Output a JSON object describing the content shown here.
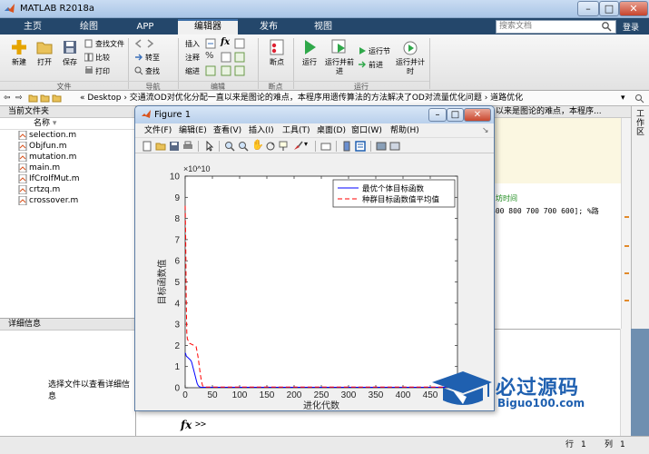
{
  "window": {
    "title": "MATLAB R2018a"
  },
  "ribbon_tabs": [
    "主页",
    "绘图",
    "APP",
    "编辑器",
    "发布",
    "视图"
  ],
  "search": {
    "placeholder": "搜索文档"
  },
  "signin": "登录",
  "ribbon": {
    "file": {
      "new": "新建",
      "open": "打开",
      "save": "保存",
      "find_files": "查找文件",
      "compare": "比较",
      "print": "打印",
      "section": "文件"
    },
    "nav": {
      "goto": "转至",
      "find": "查找",
      "section": "导航"
    },
    "edit": {
      "insert": "插入",
      "comment": "注释",
      "indent": "缩进",
      "section": "编辑"
    },
    "breakpoints": {
      "label": "断点",
      "section": "断点"
    },
    "run": {
      "run": "运行",
      "run_advance": "运行并前进",
      "run_section": "运行节",
      "advance": "前进",
      "run_time": "运行并计时",
      "section": "运行"
    }
  },
  "address": {
    "path": "« Desktop › 交通流OD对优化分配一直以来是图论的难点，本程序用遗传算法的方法解决了OD对流量优化问题 › 道路优化"
  },
  "current_folder": {
    "title": "当前文件夹",
    "column": "名称",
    "files": [
      "selection.m",
      "Objfun.m",
      "mutation.m",
      "main.m",
      "IfCroIfMut.m",
      "crtzq.m",
      "crossover.m"
    ]
  },
  "details": {
    "title": "详细信息",
    "message": "选择文件以查看详细信息"
  },
  "editor": {
    "tab_text": "以来是图论的难点，本程序...",
    "code_comment": "坊时间",
    "code_line": "400 800 700 700 600];  %路"
  },
  "workspace_label": "工作区",
  "command": {
    "fx": "fx",
    "prompt": ">>"
  },
  "status": {
    "row_label": "行",
    "row": "1",
    "col_label": "列",
    "col": "1"
  },
  "figure": {
    "title": "Figure 1",
    "menu": [
      "文件(F)",
      "编辑(E)",
      "查看(V)",
      "插入(I)",
      "工具(T)",
      "桌面(D)",
      "窗口(W)",
      "帮助(H)"
    ]
  },
  "chart_data": {
    "type": "line",
    "title": "",
    "xlabel": "进化代数",
    "ylabel": "目标函数值",
    "y_exponent": "×10^10",
    "xlim": [
      0,
      500
    ],
    "ylim": [
      0,
      10
    ],
    "xticks": [
      0,
      50,
      100,
      150,
      200,
      250,
      300,
      350,
      400,
      450
    ],
    "yticks": [
      0,
      1,
      2,
      3,
      4,
      5,
      6,
      7,
      8,
      9,
      10
    ],
    "legend_position": "top-right",
    "series": [
      {
        "name": "最优个体目标函数",
        "color": "#0000ff",
        "style": "solid",
        "x": [
          0,
          1,
          2,
          4,
          6,
          8,
          10,
          12,
          14,
          16,
          18,
          20,
          22,
          24,
          26,
          28,
          30,
          500
        ],
        "y": [
          1.65,
          1.6,
          1.5,
          1.45,
          1.4,
          1.35,
          1.3,
          1.2,
          1.0,
          0.8,
          0.6,
          0.4,
          0.2,
          0.1,
          0.05,
          0.03,
          0.02,
          0.02
        ]
      },
      {
        "name": "种群目标函数值平均值",
        "color": "#ff0000",
        "style": "dashed",
        "x": [
          0,
          1,
          2,
          3,
          4,
          6,
          8,
          12,
          16,
          20,
          22,
          24,
          26,
          28,
          30,
          32,
          34,
          36,
          500
        ],
        "y": [
          8.6,
          7.0,
          4.0,
          2.6,
          2.3,
          2.2,
          2.1,
          2.05,
          2.0,
          1.95,
          1.7,
          1.4,
          1.0,
          0.6,
          0.3,
          0.1,
          0.05,
          0.03,
          0.03
        ]
      }
    ]
  },
  "watermark": {
    "name": "必过源码",
    "url": "Biguo100.com"
  },
  "colors": {
    "tabbar": "#24476b",
    "accent": "#3d6fa7",
    "watermark": "#1f60b0"
  }
}
